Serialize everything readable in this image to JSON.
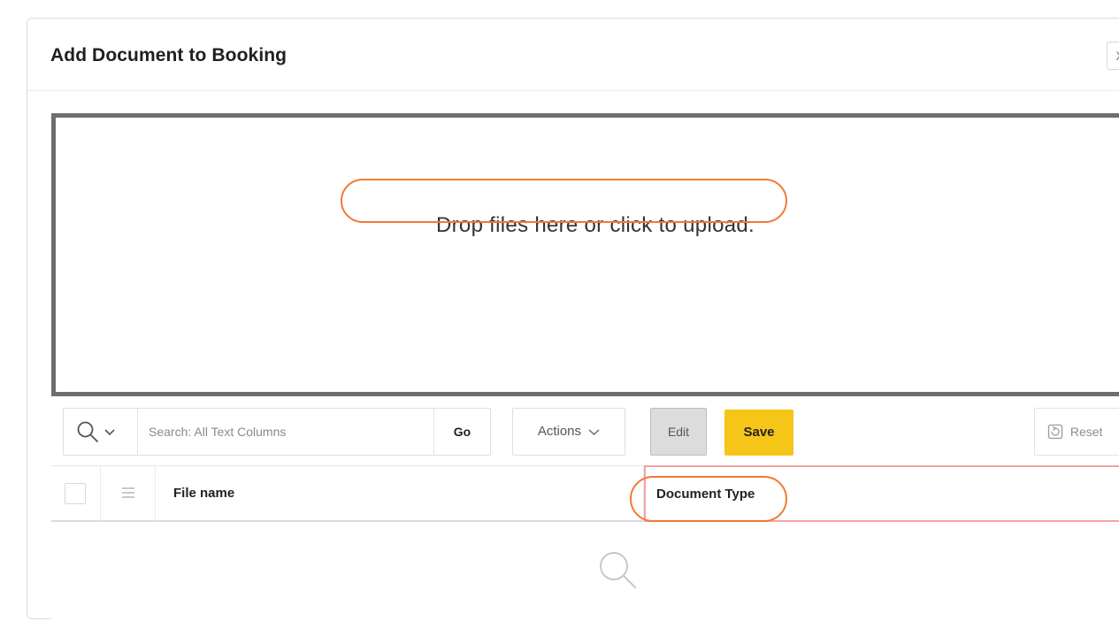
{
  "dialog": {
    "title": "Add Document to Booking",
    "close_label": "X"
  },
  "dropzone": {
    "message": "Drop files here or click to upload."
  },
  "toolbar": {
    "search_placeholder": "Search: All Text Columns",
    "go_label": "Go",
    "actions_label": "Actions",
    "edit_label": "Edit",
    "save_label": "Save",
    "reset_label": "Reset"
  },
  "grid": {
    "columns": [
      {
        "label": "File name"
      },
      {
        "label": "Document Type"
      }
    ]
  },
  "colors": {
    "save_button": "#f5c518",
    "highlight_oval": "#f07a32",
    "highlight_column_border": "#f4a2a2"
  }
}
